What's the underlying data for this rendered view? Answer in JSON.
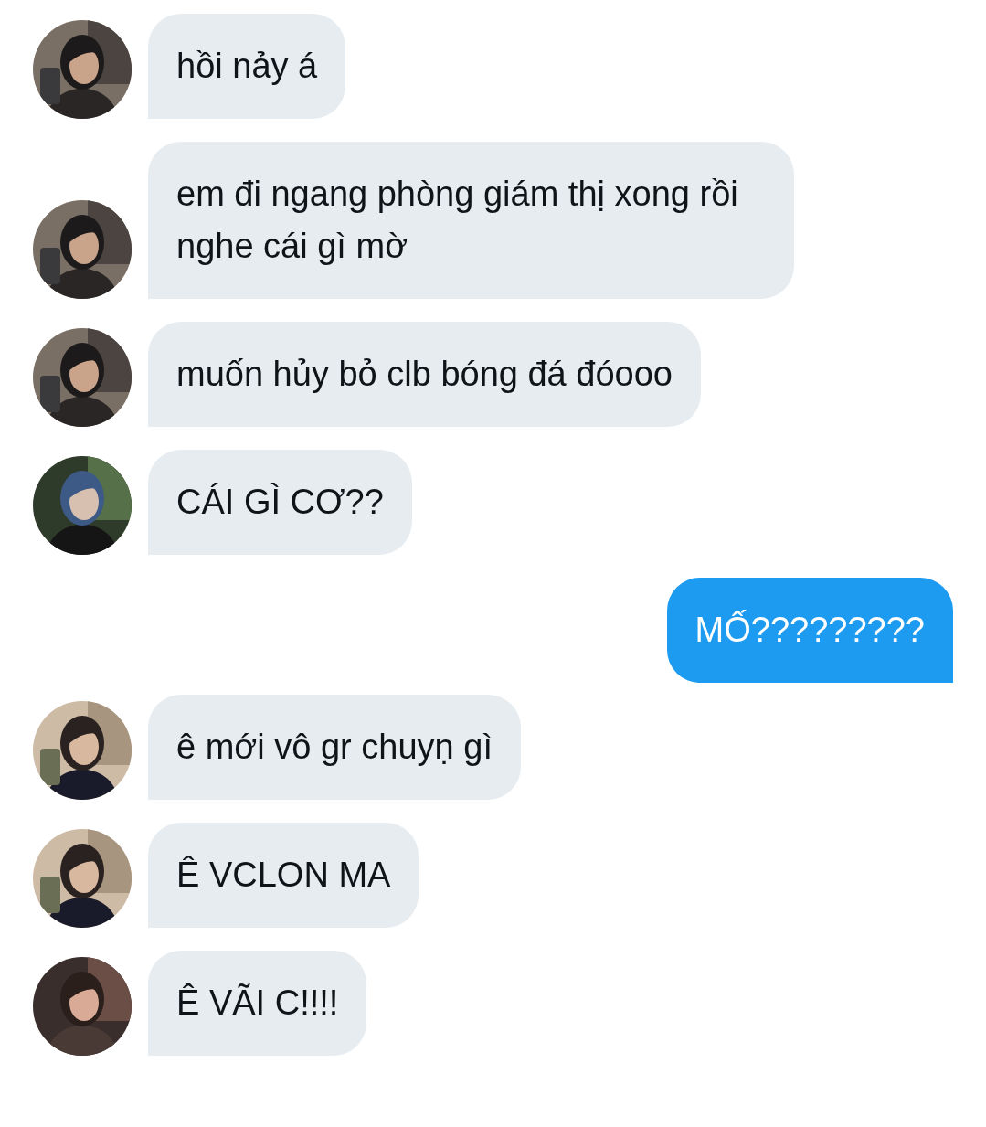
{
  "messages": [
    {
      "kind": "incoming",
      "text": "hồi nảy á"
    },
    {
      "kind": "incoming",
      "text": "em đi ngang phòng giám thị xong rồi nghe cái gì mờ"
    },
    {
      "kind": "incoming",
      "text": "muốn hủy bỏ clb bóng đá đóooo"
    },
    {
      "kind": "incoming",
      "text": "CÁI GÌ CƠ??"
    },
    {
      "kind": "outgoing",
      "text": "MỐ?????????"
    },
    {
      "kind": "incoming",
      "text": "ê mới vô gr chuyṇ gì"
    },
    {
      "kind": "incoming",
      "text": "Ê VCLON MA"
    },
    {
      "kind": "incoming",
      "text": "Ê VÃI C!!!!"
    }
  ]
}
